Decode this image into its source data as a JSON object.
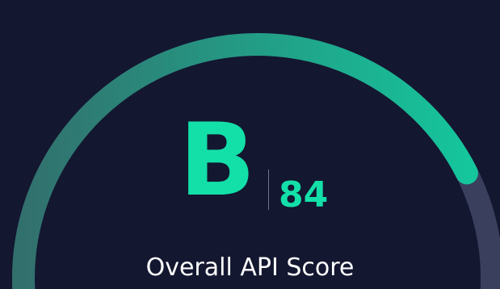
{
  "gauge": {
    "grade": "B",
    "score": "84",
    "score_value": 84,
    "score_max": 100,
    "label": "Overall API Score",
    "colors": {
      "background": "#131730",
      "track": "#3a3f5e",
      "fill_start": "#32706d",
      "fill_end": "#15c59c",
      "text_accent": "#13e0a9",
      "label_text": "#ffffff"
    }
  }
}
